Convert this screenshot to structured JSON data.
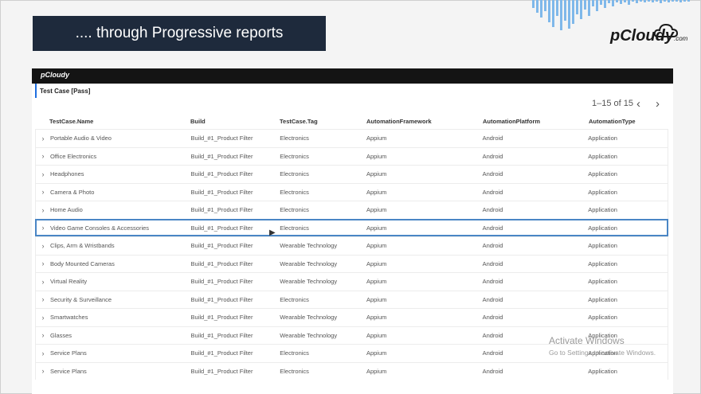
{
  "slide": {
    "title": ".... through Progressive reports",
    "brand_text": "pCloudy",
    "brand_suffix": ".com"
  },
  "report": {
    "logo": "pCloudy",
    "panel_title": "Test Case [Pass]",
    "pager_text": "1–15 of 15",
    "columns": [
      "TestCase.Name",
      "Build",
      "TestCase.Tag",
      "AutomationFramework",
      "AutomationPlatform",
      "AutomationType"
    ],
    "rows": [
      [
        "Portable Audio & Video",
        "Build_#1_Product Filter",
        "Electronics",
        "Appium",
        "Android",
        "Application"
      ],
      [
        "Office Electronics",
        "Build_#1_Product Filter",
        "Electronics",
        "Appium",
        "Android",
        "Application"
      ],
      [
        "Headphones",
        "Build_#1_Product Filter",
        "Electronics",
        "Appium",
        "Android",
        "Application"
      ],
      [
        "Camera & Photo",
        "Build_#1_Product Filter",
        "Electronics",
        "Appium",
        "Android",
        "Application"
      ],
      [
        "Home Audio",
        "Build_#1_Product Filter",
        "Electronics",
        "Appium",
        "Android",
        "Application"
      ],
      [
        "Video Game Consoles & Accessories",
        "Build_#1_Product Filter",
        "Electronics",
        "Appium",
        "Android",
        "Application"
      ],
      [
        "Clips, Arm & Wristbands",
        "Build_#1_Product Filter",
        "Wearable Technology",
        "Appium",
        "Android",
        "Application"
      ],
      [
        "Body Mounted Cameras",
        "Build_#1_Product Filter",
        "Wearable Technology",
        "Appium",
        "Android",
        "Application"
      ],
      [
        "Virtual Reality",
        "Build_#1_Product Filter",
        "Wearable Technology",
        "Appium",
        "Android",
        "Application"
      ],
      [
        "Security & Surveillance",
        "Build_#1_Product Filter",
        "Electronics",
        "Appium",
        "Android",
        "Application"
      ],
      [
        "Smartwatches",
        "Build_#1_Product Filter",
        "Wearable Technology",
        "Appium",
        "Android",
        "Application"
      ],
      [
        "Glasses",
        "Build_#1_Product Filter",
        "Wearable Technology",
        "Appium",
        "Android",
        "Application"
      ],
      [
        "Service Plans",
        "Build_#1_Product Filter",
        "Electronics",
        "Appium",
        "Android",
        "Application"
      ],
      [
        "Service Plans",
        "Build_#1_Product Filter",
        "Electronics",
        "Appium",
        "Android",
        "Application"
      ]
    ]
  },
  "watermark": {
    "line1": "Activate Windows",
    "line2": "Go to Settings to activate Windows."
  },
  "colors": {
    "title_bg": "#1e2a3c",
    "accent": "#1f6fe0",
    "wave": "#7fb8ea",
    "selection": "#4a86c5"
  }
}
